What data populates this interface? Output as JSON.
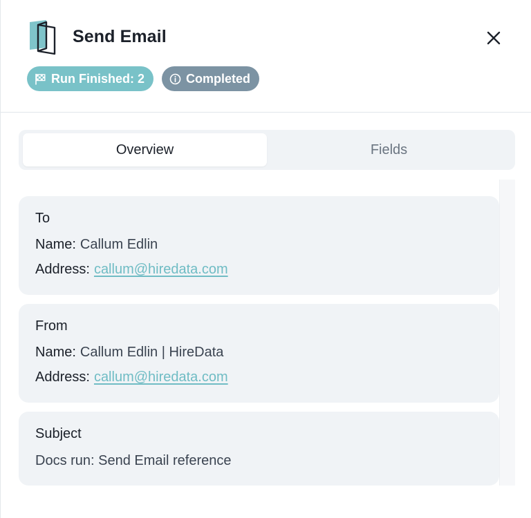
{
  "header": {
    "title": "Send Email",
    "icon": "book-open-icon",
    "badges": [
      {
        "label": "Run Finished: 2",
        "icon": "flag-icon",
        "color": "#79c2c8"
      },
      {
        "label": "Completed",
        "icon": "info-icon",
        "color": "#7c93a3"
      }
    ],
    "close_icon": "close-icon"
  },
  "tabs": [
    {
      "label": "Overview",
      "active": true
    },
    {
      "label": "Fields",
      "active": false
    }
  ],
  "cards": {
    "to": {
      "title": "To",
      "name_label": "Name:",
      "name_value": "Callum Edlin",
      "address_label": "Address:",
      "address_value": "callum@hiredata.com"
    },
    "from": {
      "title": "From",
      "name_label": "Name:",
      "name_value": "Callum Edlin | HireData",
      "address_label": "Address:",
      "address_value": "callum@hiredata.com"
    },
    "subject": {
      "title": "Subject",
      "value": "Docs run: Send Email reference"
    }
  },
  "colors": {
    "accent": "#79c2c8",
    "link": "#6fbcc4",
    "muted_badge": "#7c93a3",
    "card_bg": "#f0f3f6"
  }
}
